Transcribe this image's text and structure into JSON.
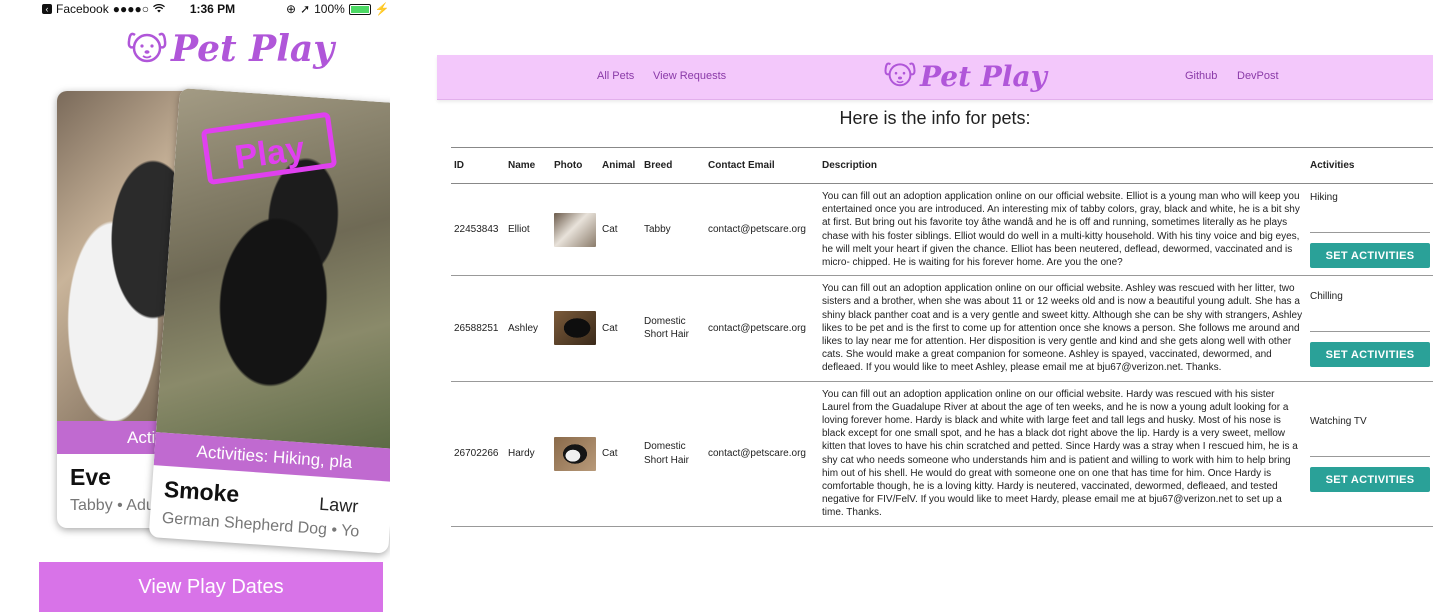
{
  "phone": {
    "status": {
      "back_app": "Facebook",
      "signal": "●●●●○",
      "time": "1:36 PM",
      "battery": "100%"
    },
    "logo_text": "Pet Play",
    "cards": [
      {
        "name": "Eve",
        "activities": "Activiti",
        "subtitle": "Tabby • Adult"
      },
      {
        "name": "Smoke",
        "stamp": "Play",
        "activities": "Activities: Hiking, pla",
        "location": "Lawr",
        "subtitle": "German Shepherd Dog • Yo"
      }
    ],
    "view_play_dates": "View Play Dates"
  },
  "web": {
    "nav": {
      "all_pets": "All Pets",
      "view_requests": "View Requests",
      "logo_text": "Pet Play",
      "github": "Github",
      "devpost": "DevPost"
    },
    "heading": "Here is the info for pets:",
    "columns": [
      "ID",
      "Name",
      "Photo",
      "Animal",
      "Breed",
      "Contact Email",
      "Description",
      "Activities"
    ],
    "set_activities_label": "SET ACTIVITIES",
    "pets": [
      {
        "id": "22453843",
        "name": "Elliot",
        "animal": "Cat",
        "breed": "Tabby",
        "email": "contact@petscare.org",
        "description": "You can fill out an adoption application online on our official website. Elliot is a young man who will keep you entertained once you are introduced. An interesting mix of tabby colors, gray, black and white, he is a bit shy at first. But bring out his favorite toy âthe wandâ and he is off and running, sometimes literally as he plays chase with his foster siblings. Elliot would do well in a multi-kitty household. With his tiny voice and big eyes, he will melt your heart if given the chance. Elliot has been neutered, deflead, dewormed, vaccinated and is micro- chipped. He is waiting for his forever home. Are you the one?",
        "activity": "Hiking"
      },
      {
        "id": "26588251",
        "name": "Ashley",
        "animal": "Cat",
        "breed": "Domestic Short Hair",
        "email": "contact@petscare.org",
        "description": "You can fill out an adoption application online on our official website. Ashley was rescued with her litter, two sisters and a brother, when she was about 11 or 12 weeks old and is now a beautiful young adult. She has a shiny black panther coat and is a very gentle and sweet kitty. Although she can be shy with strangers, Ashley likes to be pet and is the first to come up for attention once she knows a person. She follows me around and likes to lay near me for attention. Her disposition is very gentle and kind and she gets along well with other cats. She would make a great companion for someone. Ashley is spayed, vaccinated, dewormed, and defleaed. If you would like to meet Ashley, please email me at bju67@verizon.net. Thanks.",
        "activity": "Chilling"
      },
      {
        "id": "26702266",
        "name": "Hardy",
        "animal": "Cat",
        "breed": "Domestic Short Hair",
        "email": "contact@petscare.org",
        "description": "You can fill out an adoption application online on our official website. Hardy was rescued with his sister Laurel from the Guadalupe River at about the age of ten weeks, and he is now a young adult looking for a loving forever home. Hardy is black and white with large feet and tall legs and husky. Most of his nose is black except for one small spot, and he has a black dot right above the lip. Hardy is a very sweet, mellow kitten that loves to have his chin scratched and petted. Since Hardy was a stray when I rescued him, he is a shy cat who needs someone who understands him and is patient and willing to work with him to help bring him out of his shell. He would do great with someone one on one that has time for him. Once Hardy is comfortable though, he is a loving kitty. Hardy is neutered, vaccinated, dewormed, defleaed, and tested negative for FIV/FelV. If you would like to meet Hardy, please email me at bju67@verizon.net to set up a time. Thanks.",
        "activity": "Watching TV"
      }
    ]
  },
  "colors": {
    "brand_purple": "#b056d9",
    "nav_background": "#f3c8fb",
    "button_teal": "#2aa198",
    "play_dates_pink": "#d873e8"
  }
}
